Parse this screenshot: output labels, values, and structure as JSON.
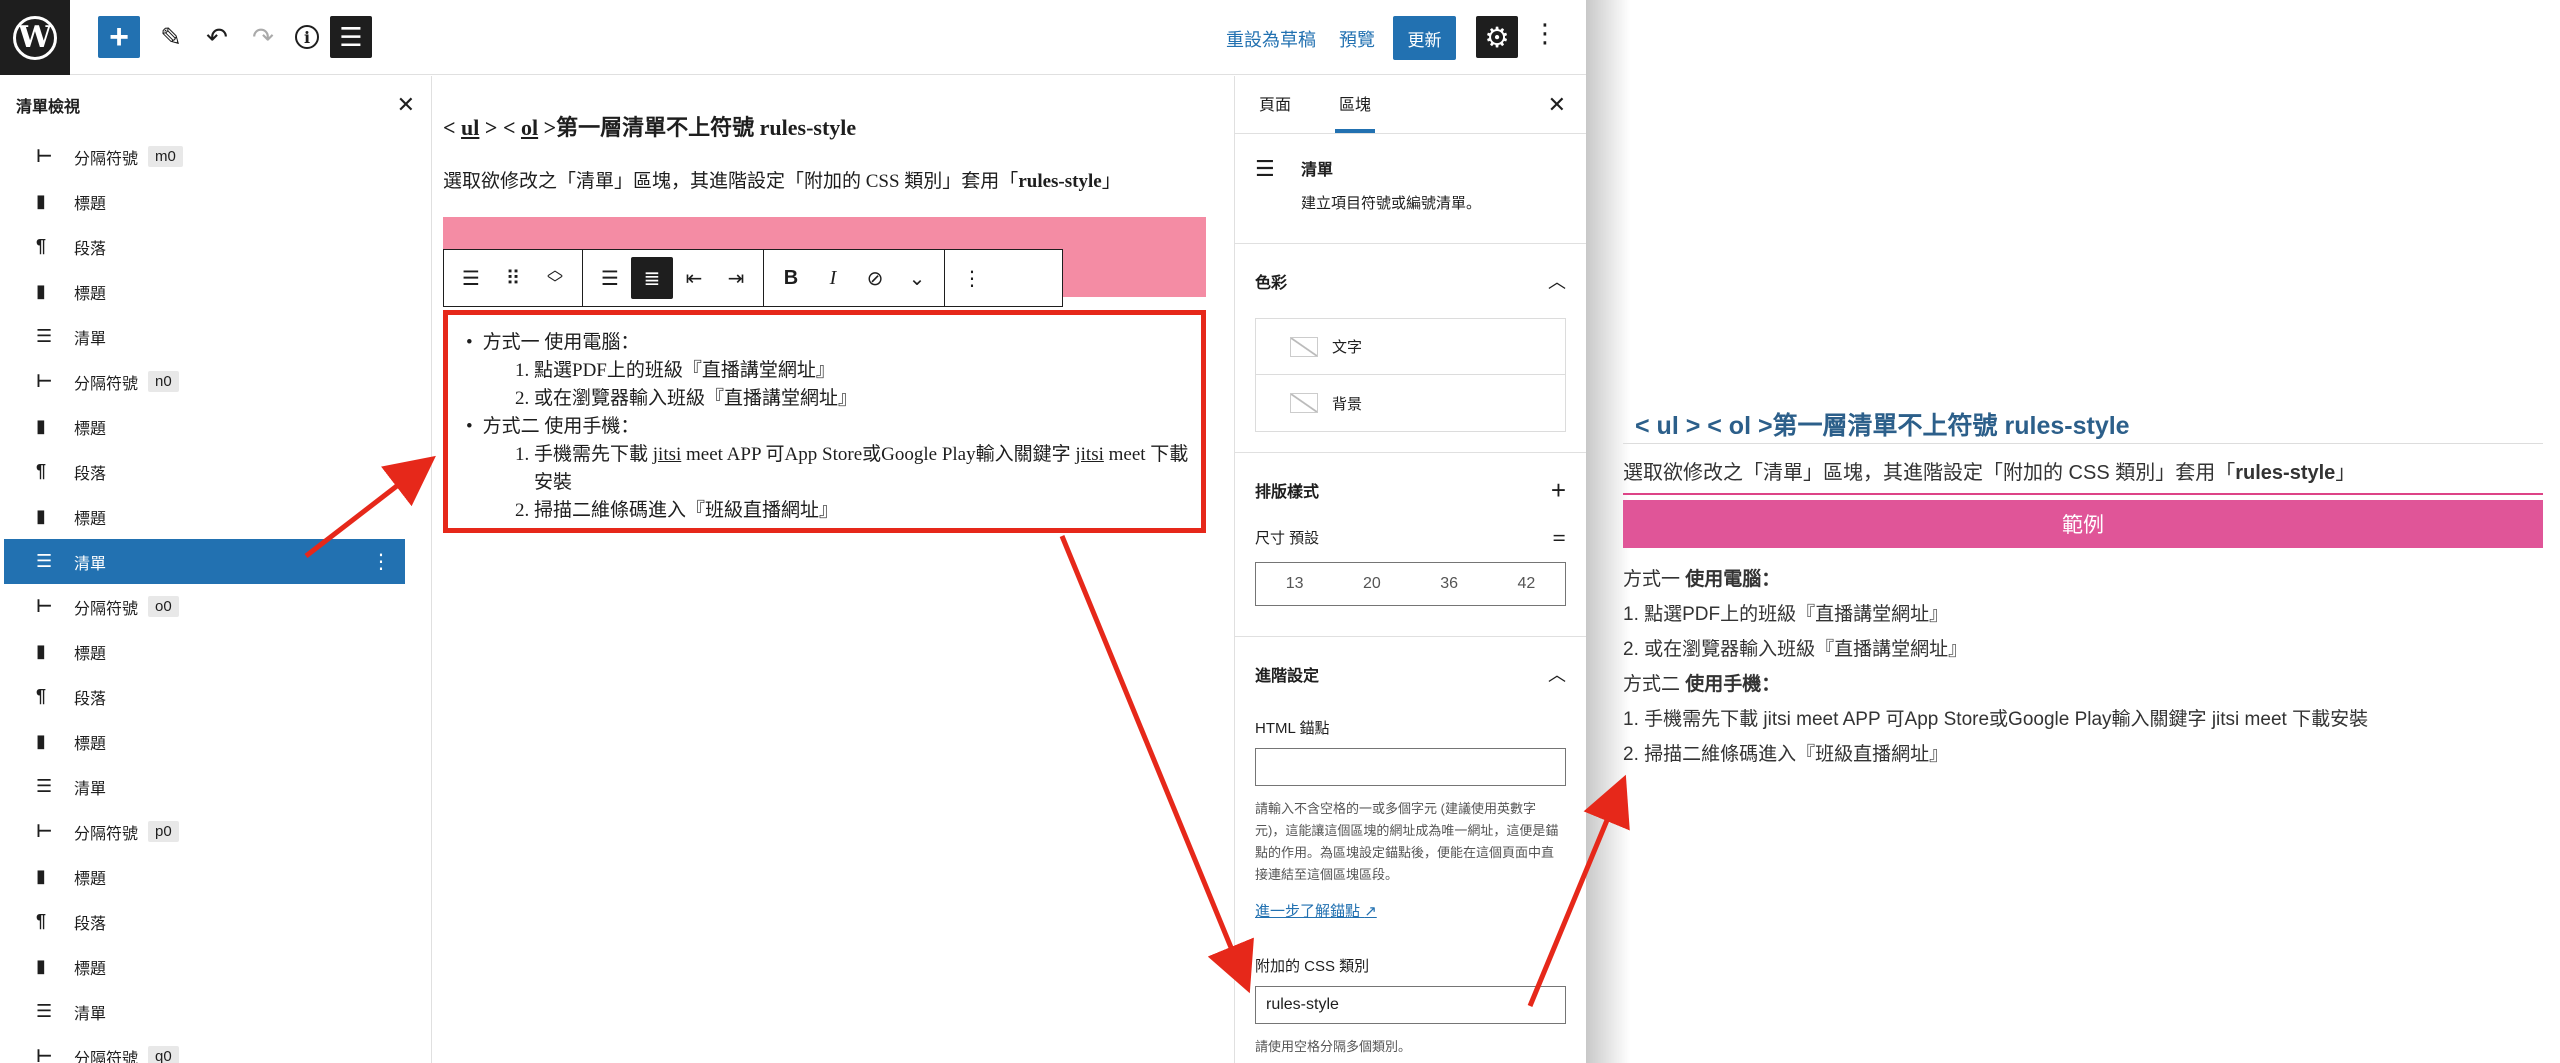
{
  "topbar": {
    "save_draft": "重設為草稿",
    "preview": "預覽",
    "update": "更新"
  },
  "listview": {
    "title": "清單檢視",
    "items": [
      {
        "icon": "separator-icon",
        "label": "分隔符號",
        "anchor": "m0"
      },
      {
        "icon": "heading-icon",
        "label": "標題"
      },
      {
        "icon": "paragraph-icon",
        "label": "段落"
      },
      {
        "icon": "heading-icon",
        "label": "標題"
      },
      {
        "icon": "list-icon",
        "label": "清單"
      },
      {
        "icon": "separator-icon",
        "label": "分隔符號",
        "anchor": "n0"
      },
      {
        "icon": "heading-icon",
        "label": "標題"
      },
      {
        "icon": "paragraph-icon",
        "label": "段落"
      },
      {
        "icon": "heading-icon",
        "label": "標題"
      },
      {
        "icon": "list-icon",
        "label": "清單",
        "selected": true
      },
      {
        "icon": "separator-icon",
        "label": "分隔符號",
        "anchor": "o0"
      },
      {
        "icon": "heading-icon",
        "label": "標題"
      },
      {
        "icon": "paragraph-icon",
        "label": "段落"
      },
      {
        "icon": "heading-icon",
        "label": "標題"
      },
      {
        "icon": "list-icon",
        "label": "清單"
      },
      {
        "icon": "separator-icon",
        "label": "分隔符號",
        "anchor": "p0"
      },
      {
        "icon": "heading-icon",
        "label": "標題"
      },
      {
        "icon": "paragraph-icon",
        "label": "段落"
      },
      {
        "icon": "heading-icon",
        "label": "標題"
      },
      {
        "icon": "list-icon",
        "label": "清單"
      },
      {
        "icon": "separator-icon",
        "label": "分隔符號",
        "anchor": "q0"
      }
    ]
  },
  "canvas": {
    "title_ul": "ul",
    "title_ol": "ol",
    "title_rest": "第一層清單不上符號 rules-style",
    "desc_a": "選取欲修改之「清單」區塊，其進階設定「附加的 CSS 類別」套用「",
    "desc_b": "rules-style",
    "desc_c": "」",
    "list": {
      "item1": "方式一 使用電腦：",
      "item1_sub": [
        "點選PDF上的班級『直播講堂網址』",
        "或在瀏覽器輸入班級『直播講堂網址』"
      ],
      "item2": "方式二 使用手機：",
      "item2_sub_a": "手機需先下載 ",
      "item2_sub_jitsi1": "jitsi",
      "item2_sub_b": " meet APP 可App Store或Google Play輸入關鍵字 ",
      "item2_sub_jitsi2": "jitsi",
      "item2_sub_c": " meet 下載安裝",
      "item2_sub2": "掃描二維條碼進入『班級直播網址』"
    }
  },
  "settings": {
    "tab_page": "頁面",
    "tab_block": "區塊",
    "block_title": "清單",
    "block_desc": "建立項目符號或編號清單。",
    "color_title": "色彩",
    "color_text": "文字",
    "color_bg": "背景",
    "typo_title": "排版樣式",
    "size_label": "尺寸 預設",
    "sizes": [
      "13",
      "20",
      "36",
      "42"
    ],
    "advanced_title": "進階設定",
    "html_anchor_label": "HTML 錨點",
    "html_anchor_value": "",
    "html_anchor_help": "請輸入不含空格的一或多個字元 (建議使用英數字元)，這能讓這個區塊的網址成為唯一網址，這便是錨點的作用。為區塊設定錨點後，便能在這個頁面中直接連結至這個區塊區段。",
    "learn_more": "進一步了解錨點",
    "css_class_label": "附加的 CSS 類別",
    "css_class_value": "rules-style",
    "css_class_help": "請使用空格分隔多個類別。"
  },
  "preview": {
    "title": "< ul > < ol >第一層清單不上符號 rules-style",
    "desc_a": "選取欲修改之「清單」區塊，其進階設定「附加的 CSS 類別」套用「",
    "desc_b": "rules-style",
    "desc_c": "」",
    "example": "範例",
    "list": [
      {
        "pre": "方式一 ",
        "bold": "使用電腦：",
        "text": ""
      },
      {
        "pre": "",
        "bold": "",
        "text": "1. 點選PDF上的班級『直播講堂網址』"
      },
      {
        "pre": "",
        "bold": "",
        "text": "2. 或在瀏覽器輸入班級『直播講堂網址』"
      },
      {
        "pre": "方式二 ",
        "bold": "使用手機：",
        "text": ""
      },
      {
        "pre": "",
        "bold": "",
        "text": "1. 手機需先下載 jitsi meet APP 可App Store或Google Play輸入關鍵字 jitsi meet 下載安裝"
      },
      {
        "pre": "",
        "bold": "",
        "text": "2. 掃描二維條碼進入『班級直播網址』"
      }
    ]
  },
  "colors": {
    "wp_blue": "#2271b1",
    "pink_block": "#f48ca4",
    "preview_pink": "#e05598",
    "arrow_red": "#e6281a",
    "preview_title": "#2c5f8a"
  }
}
